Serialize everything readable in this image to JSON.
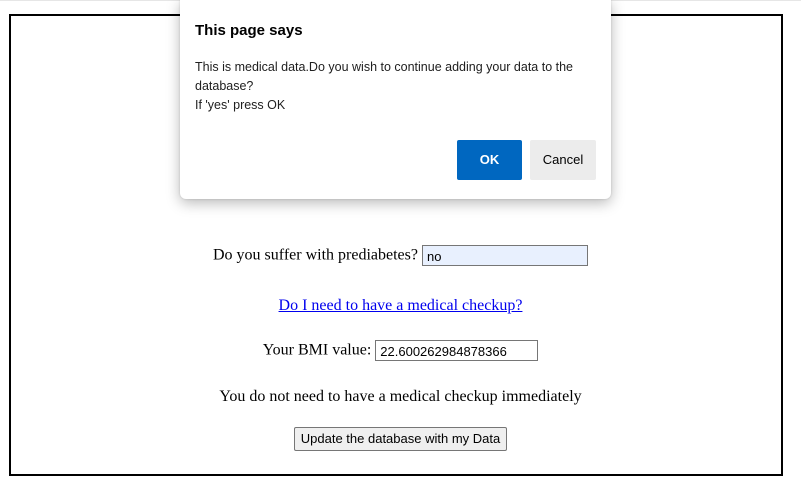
{
  "form": {
    "prediabetes_label": "Do you suffer with prediabetes?",
    "prediabetes_value": "no",
    "checkup_link": "Do I need to have a medical checkup?",
    "bmi_label": "Your BMI value:",
    "bmi_value": "22.600262984878366",
    "advice_text": "You do not need to have a medical checkup immediately",
    "update_button": "Update the database with my Data"
  },
  "dialog": {
    "title": "This page says",
    "message_line1": "This is medical data.Do you wish to continue adding your data to the database?",
    "message_line2": "If 'yes' press OK",
    "ok_label": "OK",
    "cancel_label": "Cancel"
  },
  "colors": {
    "ok_button": "#0067c0",
    "link": "#0000ee",
    "autofill_field": "#e8f0fe"
  }
}
